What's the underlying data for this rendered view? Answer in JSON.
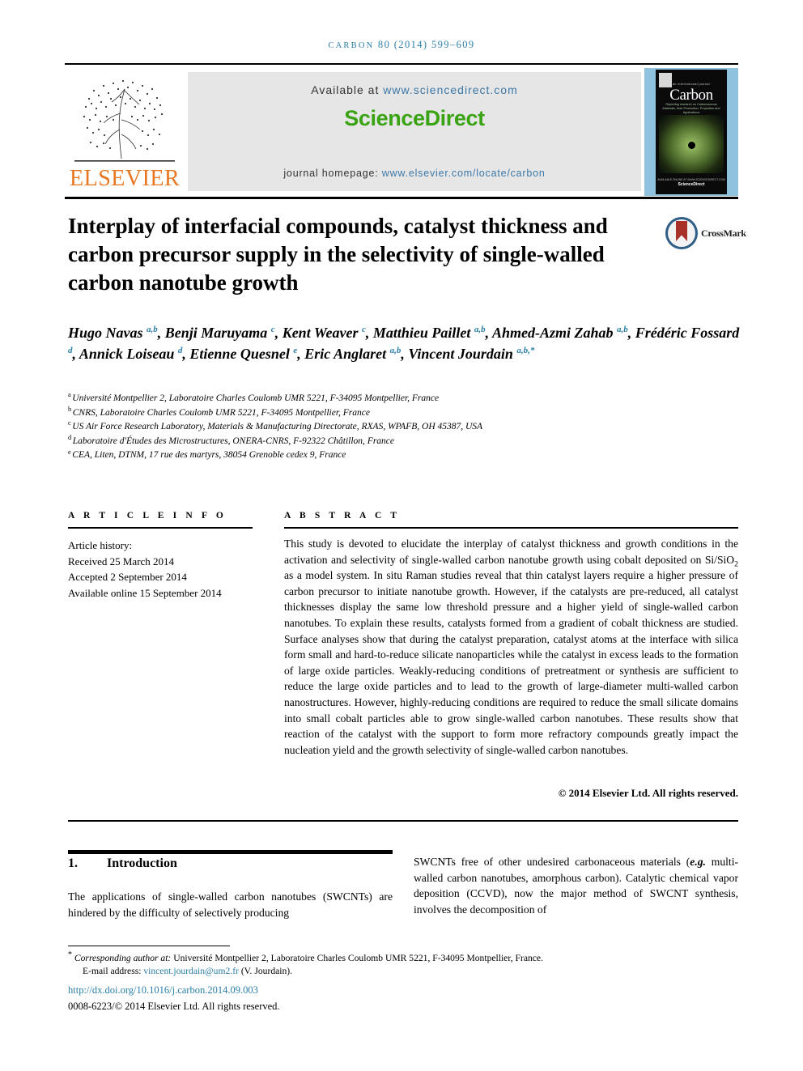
{
  "running_head": {
    "journal": "CARBON",
    "citation": "80 (2014) 599–609",
    "full": "CARBON 80 (2014) 599–609"
  },
  "masthead": {
    "publisher_logo_text": "ELSEVIER",
    "available_at_prefix": "Available at ",
    "available_at_link": "www.sciencedirect.com",
    "sciencedirect_logo": "ScienceDirect",
    "homepage_prefix": "journal homepage: ",
    "homepage_link": "www.elsevier.com/locate/carbon",
    "cover": {
      "international_line": "an international journal",
      "title": "Carbon",
      "subtitle": "Reporting research on Carbonaceous Materials, their Production, Properties and Applications",
      "footer_small": "AVAILABLE ONLINE AT WWW.SCIENCEDIRECT.COM",
      "footer_brand": "ScienceDirect"
    }
  },
  "article": {
    "title": "Interplay of interfacial compounds, catalyst thickness and carbon precursor supply in the selectivity of single-walled carbon nanotube growth",
    "crossmark_label": "CrossMark",
    "authors_html": "Hugo Navas <sup>a,b</sup>, Benji Maruyama <sup>c</sup>, Kent Weaver <sup>c</sup>, Matthieu Paillet <sup>a,b</sup>, Ahmed-Azmi Zahab <sup>a,b</sup>, Frédéric Fossard <sup>d</sup>, Annick Loiseau <sup>d</sup>, Etienne Quesnel <sup>e</sup>, Eric Anglaret <sup>a,b</sup>, Vincent Jourdain <sup>a,b,*</sup>",
    "affiliations": [
      {
        "marker": "a",
        "text": "Université Montpellier 2, Laboratoire Charles Coulomb UMR 5221, F-34095 Montpellier, France"
      },
      {
        "marker": "b",
        "text": "CNRS, Laboratoire Charles Coulomb UMR 5221, F-34095 Montpellier, France"
      },
      {
        "marker": "c",
        "text": "US Air Force Research Laboratory, Materials & Manufacturing Directorate, RXAS, WPAFB, OH 45387, USA"
      },
      {
        "marker": "d",
        "text": "Laboratoire d'Études des Microstructures, ONERA-CNRS, F-92322 Châtillon, France"
      },
      {
        "marker": "e",
        "text": "CEA, Liten, DTNM, 17 rue des martyrs, 38054 Grenoble cedex 9, France"
      }
    ]
  },
  "article_info": {
    "heading": "A R T I C L E   I N F O",
    "history_label": "Article history:",
    "received": "Received 25 March 2014",
    "accepted": "Accepted 2 September 2014",
    "available_online": "Available online 15 September 2014"
  },
  "abstract": {
    "heading": "A B S T R A C T",
    "text_part1": "This study is devoted to elucidate the interplay of catalyst thickness and growth conditions in the activation and selectivity of single-walled carbon nanotube growth using cobalt deposited on Si/SiO",
    "subscript": "2",
    "text_part2": " as a model system. In situ Raman studies reveal that thin catalyst layers require a higher pressure of carbon precursor to initiate nanotube growth. However, if the catalysts are pre-reduced, all catalyst thicknesses display the same low threshold pressure and a higher yield of single-walled carbon nanotubes. To explain these results, catalysts formed from a gradient of cobalt thickness are studied. Surface analyses show that during the catalyst preparation, catalyst atoms at the interface with silica form small and hard-to-reduce silicate nanoparticles while the catalyst in excess leads to the formation of large oxide particles. Weakly-reducing conditions of pretreatment or synthesis are sufficient to reduce the large oxide particles and to lead to the growth of large-diameter multi-walled carbon nanostructures. However, highly-reducing conditions are required to reduce the small silicate domains into small cobalt particles able to grow single-walled carbon nanotubes. These results show that reaction of the catalyst with the support to form more refractory compounds greatly impact the nucleation yield and the growth selectivity of single-walled carbon nanotubes.",
    "copyright": "© 2014 Elsevier Ltd. All rights reserved."
  },
  "body": {
    "section_number": "1.",
    "section_title": "Introduction",
    "left_column": "The applications of single-walled carbon nanotubes (SWCNTs) are hindered by the difficulty of selectively producing",
    "right_column_pre": "SWCNTs free of other undesired carbonaceous materials (",
    "right_column_em": "e.g.",
    "right_column_post": " multi-walled carbon nanotubes, amorphous carbon). Catalytic chemical vapor deposition (CCVD), now the major method of SWCNT synthesis, involves the decomposition of"
  },
  "footer": {
    "corresponding_label": "Corresponding author at:",
    "corresponding_text": " Université Montpellier 2, Laboratoire Charles Coulomb UMR 5221, F-34095 Montpellier, France.",
    "email_label": "E-mail address: ",
    "email_address": "vincent.jourdain@um2.fr",
    "email_suffix": " (V. Jourdain).",
    "doi": "http://dx.doi.org/10.1016/j.carbon.2014.09.003",
    "issn_line": "0008-6223/© 2014 Elsevier Ltd. All rights reserved."
  },
  "colors": {
    "link_blue": "#2b7fa8",
    "sciencedirect_green": "#3aa314",
    "elsevier_orange": "#E87722",
    "banner_gray": "#e6e6e6",
    "cover_blue": "#8fc3dd"
  }
}
